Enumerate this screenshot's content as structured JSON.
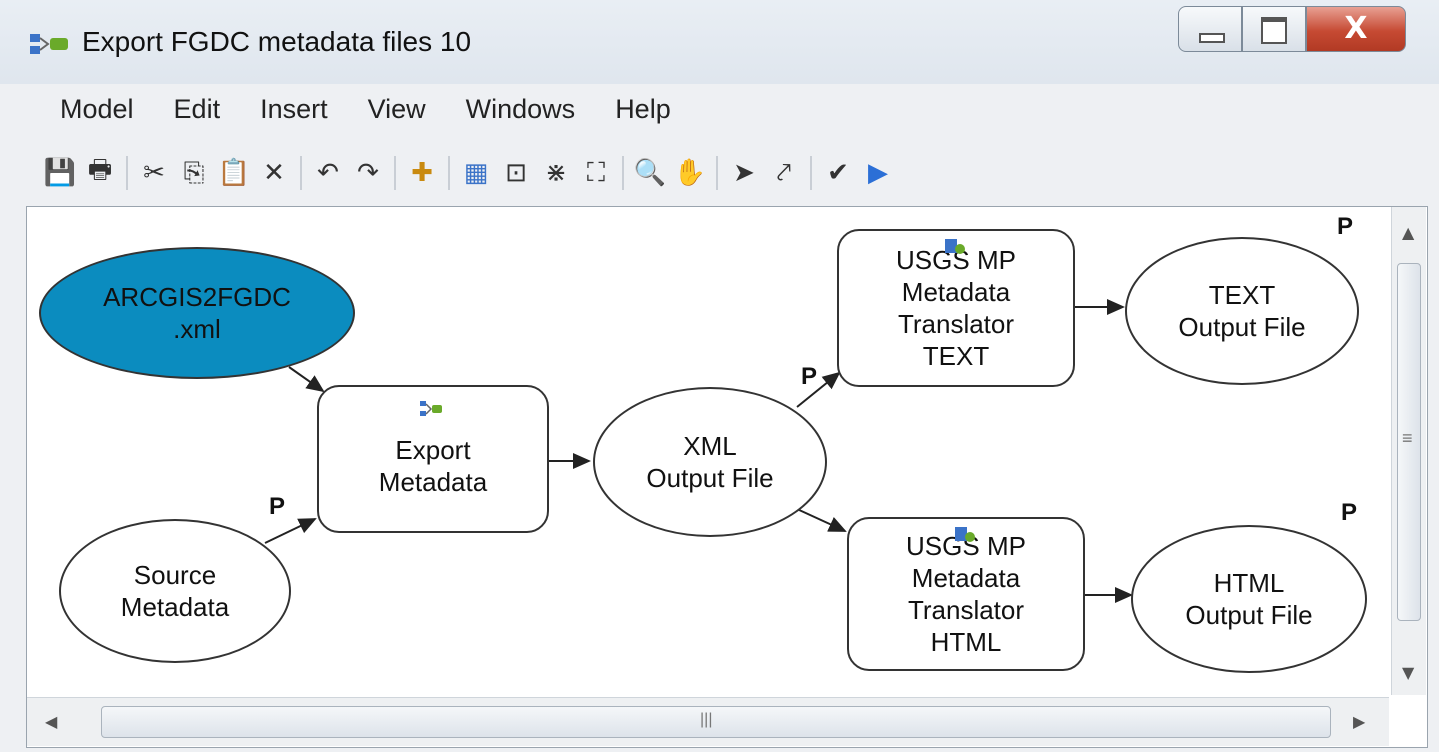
{
  "window": {
    "title": "Export FGDC metadata files 10",
    "close_glyph": "X",
    "min_glyph": "—",
    "max_glyph": "▢"
  },
  "menu": [
    "Model",
    "Edit",
    "Insert",
    "View",
    "Windows",
    "Help"
  ],
  "toolbar": [
    {
      "name": "save-icon",
      "glyph": "💾"
    },
    {
      "name": "print-icon",
      "glyph": "🖶"
    },
    {
      "sep": true
    },
    {
      "name": "cut-icon",
      "glyph": "✂"
    },
    {
      "name": "copy-icon",
      "glyph": "⎘"
    },
    {
      "name": "paste-icon",
      "glyph": "📋"
    },
    {
      "name": "delete-icon",
      "glyph": "✕"
    },
    {
      "sep": true
    },
    {
      "name": "undo-icon",
      "glyph": "↶"
    },
    {
      "name": "redo-icon",
      "glyph": "↷"
    },
    {
      "sep": true
    },
    {
      "name": "add-data-icon",
      "glyph": "✚"
    },
    {
      "sep": true
    },
    {
      "name": "auto-layout-icon",
      "glyph": "▦"
    },
    {
      "name": "full-extent-icon",
      "glyph": "⊡"
    },
    {
      "name": "fixed-zoom-in-icon",
      "glyph": "⋇"
    },
    {
      "name": "fixed-zoom-out-icon",
      "glyph": "⛶"
    },
    {
      "sep": true
    },
    {
      "name": "zoom-in-icon",
      "glyph": "🔍"
    },
    {
      "name": "pan-icon",
      "glyph": "✋"
    },
    {
      "sep": true
    },
    {
      "name": "select-icon",
      "glyph": "➤"
    },
    {
      "name": "connect-icon",
      "glyph": "⤤"
    },
    {
      "sep": true
    },
    {
      "name": "validate-icon",
      "glyph": "✔"
    },
    {
      "name": "run-icon",
      "glyph": "▶"
    }
  ],
  "diagram": {
    "nodes": {
      "arcgis2fgdc": [
        "ARCGIS2FGDC",
        ".xml"
      ],
      "source_metadata": [
        "Source",
        "Metadata"
      ],
      "export_metadata": [
        "Export",
        "Metadata"
      ],
      "xml_output": [
        "XML",
        "Output File"
      ],
      "usgs_text": [
        "USGS MP",
        "Metadata",
        "Translator",
        "TEXT"
      ],
      "text_output": [
        "TEXT",
        "Output File"
      ],
      "usgs_html": [
        "USGS MP",
        "Metadata",
        "Translator",
        "HTML"
      ],
      "html_output": [
        "HTML",
        "Output File"
      ]
    },
    "p_label": "P"
  },
  "colors": {
    "input_fill": "#0b8cbf",
    "node_border": "#333333",
    "tool_icon_blue": "#3b73c8",
    "tool_icon_green": "#6aaa2a"
  },
  "scroll": {
    "h_grip": "|||",
    "v_grip": "≡",
    "up": "▲",
    "down": "▼",
    "left": "◀",
    "right": "▶"
  }
}
